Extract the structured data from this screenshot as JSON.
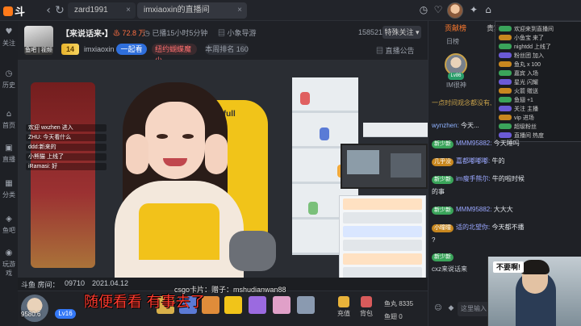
{
  "topbar": {
    "logo": "斗鱼",
    "tabs": [
      {
        "label": "zard1991"
      },
      {
        "label": "imxiaoxin的直播间"
      }
    ],
    "close": "×"
  },
  "sidebar": {
    "items": [
      {
        "label": "关注",
        "icon": "heart-icon"
      },
      {
        "label": "历史",
        "icon": "clock-icon"
      },
      {
        "label": "首页",
        "icon": "home-icon"
      },
      {
        "label": "直播",
        "icon": "tv-icon"
      },
      {
        "label": "分类",
        "icon": "grid-icon"
      },
      {
        "label": "鱼吧",
        "icon": "fish-icon"
      },
      {
        "label": "玩游戏",
        "icon": "gamepad-icon"
      }
    ]
  },
  "room": {
    "avatar_label": "鱼吧 | 视频",
    "title": "【来说话来•】",
    "hot": "72.8 万",
    "live_time": "已播15小时5分钟",
    "category": "小象导游",
    "room_id": "1585213",
    "follow_label": "特殊关注",
    "level": "14",
    "anchor": "imxiaoxin",
    "tag_blue": "一起看",
    "tag_red": "纽约蝴蝶魔少",
    "week_rank": "本周排名 160",
    "announce": "直播公告"
  },
  "video": {
    "chair_logo": "Autofull",
    "watermark": "斗鱼",
    "stream_chat": [
      "欢迎 wxzhen 进入",
      "ZHU: 今天看什么",
      "ddd:新来的",
      "小熊猫 上线了",
      "iRamasi: 好"
    ]
  },
  "meta": {
    "left": "斗鱼 房间：",
    "stamp": "09710",
    "date": "2021.04.12",
    "caption": "csgo卡片：赠子：mshudianwan88"
  },
  "subtitle": "随便看看 有事去了",
  "giftbar": {
    "coins": "9580.6",
    "level": "Lv16",
    "charge_label": "充值",
    "bag_label": "背包",
    "fish_ball": "鱼丸 8335",
    "fish_wing": "鱼翅 0"
  },
  "right": {
    "tabs": [
      "贡献榜",
      "贵宾"
    ],
    "sub": "日榜",
    "top_user": "IM很神",
    "top_level": "Lv86",
    "mini_list": [
      "欢迎来到直播间",
      "小鱼宝 来了",
      "nightdd 上线了",
      "粉丝团 加入",
      "鱼丸 x 100",
      "嘉宾 入场",
      "星光 闪耀",
      "火箭 赠送",
      "鱼翅 +1",
      "关注 主播",
      "vip 进场",
      "超级粉丝",
      "直播间 热度"
    ],
    "chat": [
      {
        "badge": "",
        "user": "",
        "text": "一点时间观念都没有,"
      },
      {
        "badge": "",
        "user": "wynzhen:",
        "text": "今天..."
      },
      {
        "badge": "新少新",
        "user": "MMM95882:",
        "text": "今天睡吗"
      },
      {
        "badge": "几乎没",
        "user": "嘉都嘟嘟嘟:",
        "text": "牛的"
      },
      {
        "badge": "新少新",
        "user": "im瘦手熊尔:",
        "text": "牛的啦时候"
      },
      {
        "badge": "",
        "user": "",
        "text": "的事"
      },
      {
        "badge": "新少新",
        "user": "MMM95882:",
        "text": "大大大"
      },
      {
        "badge": "小曈曈",
        "user": "适的北望你:",
        "text": "今天都不播"
      },
      {
        "badge": "",
        "user": "",
        "text": "?"
      },
      {
        "badge": "新少新",
        "user": "",
        "text": ""
      },
      {
        "badge": "",
        "user": "cxz来说话来",
        "text": ""
      }
    ],
    "input_placeholder": "这里输入",
    "cam_label": "不要啊!"
  }
}
